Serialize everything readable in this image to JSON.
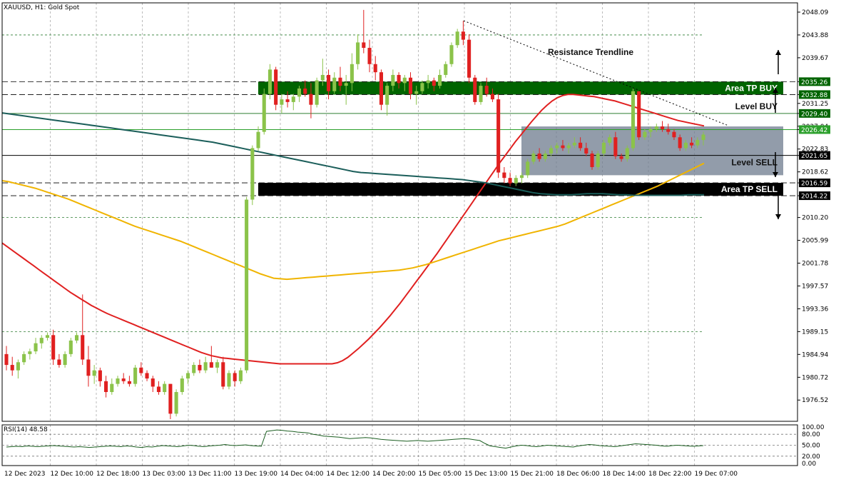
{
  "chart_data": {
    "type": "candlestick",
    "title": "XAUUSD, H1:  Gold Spot",
    "symbol": "XAUUSD",
    "timeframe": "H1",
    "instrument": "Gold Spot",
    "ylim": [
      1972.6,
      2049.8
    ],
    "y_ticks": [
      "2048.09",
      "2043.88",
      "2039.67",
      "2035.26",
      "2032.88",
      "2031.25",
      "2029.40",
      "2027.04",
      "2026.42",
      "2022.83",
      "2021.65",
      "2018.62",
      "2016.59",
      "2014.22",
      "2010.20",
      "2005.99",
      "2001.78",
      "1997.57",
      "1993.36",
      "1989.15",
      "1984.94",
      "1980.72",
      "1976.52"
    ],
    "x_labels": [
      "12 Dec 2023",
      "12 Dec 10:00",
      "12 Dec 18:00",
      "13 Dec 03:00",
      "13 Dec 11:00",
      "13 Dec 19:00",
      "14 Dec 04:00",
      "14 Dec 12:00",
      "14 Dec 20:00",
      "15 Dec 05:00",
      "15 Dec 13:00",
      "15 Dec 21:00",
      "18 Dec 06:00",
      "18 Dec 14:00",
      "18 Dec 22:00",
      "19 Dec 07:00"
    ],
    "grid": true,
    "candles": [
      [
        1985.0,
        1986.5,
        1982.0,
        1983.0
      ],
      [
        1983.0,
        1984.5,
        1981.0,
        1982.0
      ],
      [
        1982.0,
        1984.0,
        1980.5,
        1983.5
      ],
      [
        1983.5,
        1985.5,
        1983.0,
        1985.0
      ],
      [
        1985.0,
        1986.0,
        1984.0,
        1985.5
      ],
      [
        1985.5,
        1988.0,
        1985.0,
        1987.0
      ],
      [
        1987.0,
        1988.5,
        1986.0,
        1988.0
      ],
      [
        1988.0,
        1989.0,
        1987.5,
        1988.5
      ],
      [
        1988.5,
        1989.5,
        1983.0,
        1984.0
      ],
      [
        1984.0,
        1985.0,
        1982.5,
        1983.0
      ],
      [
        1983.0,
        1985.5,
        1982.5,
        1985.0
      ],
      [
        1985.0,
        1988.0,
        1984.5,
        1987.5
      ],
      [
        1987.5,
        1989.0,
        1987.0,
        1988.5
      ],
      [
        1988.5,
        1996.0,
        1983.0,
        1984.0
      ],
      [
        1984.0,
        1986.5,
        1979.0,
        1981.0
      ],
      [
        1981.0,
        1983.0,
        1979.5,
        1982.0
      ],
      [
        1982.0,
        1982.5,
        1979.0,
        1980.0
      ],
      [
        1980.0,
        1981.0,
        1977.0,
        1978.0
      ],
      [
        1978.0,
        1980.5,
        1977.5,
        1979.5
      ],
      [
        1979.5,
        1981.0,
        1979.0,
        1980.5
      ],
      [
        1980.5,
        1981.5,
        1979.5,
        1980.0
      ],
      [
        1980.0,
        1981.0,
        1979.0,
        1979.5
      ],
      [
        1979.5,
        1983.0,
        1979.0,
        1982.5
      ],
      [
        1982.5,
        1983.5,
        1981.0,
        1981.5
      ],
      [
        1981.5,
        1982.0,
        1980.0,
        1980.5
      ],
      [
        1980.5,
        1981.0,
        1978.0,
        1979.0
      ],
      [
        1979.0,
        1980.0,
        1977.5,
        1978.0
      ],
      [
        1978.0,
        1980.0,
        1977.5,
        1979.5
      ],
      [
        1979.5,
        1979.5,
        1973.0,
        1974.0
      ],
      [
        1974.0,
        1978.5,
        1973.5,
        1978.0
      ],
      [
        1978.0,
        1981.0,
        1977.5,
        1980.5
      ],
      [
        1980.5,
        1982.0,
        1979.5,
        1981.5
      ],
      [
        1981.5,
        1983.5,
        1981.0,
        1983.0
      ],
      [
        1983.0,
        1984.0,
        1981.5,
        1982.0
      ],
      [
        1982.0,
        1984.5,
        1981.5,
        1983.5
      ],
      [
        1983.5,
        1986.5,
        1982.5,
        1982.5
      ],
      [
        1982.5,
        1984.0,
        1981.5,
        1983.5
      ],
      [
        1983.5,
        1984.5,
        1978.5,
        1979.0
      ],
      [
        1979.0,
        1982.0,
        1978.5,
        1981.5
      ],
      [
        1981.5,
        1982.0,
        1979.0,
        1980.0
      ],
      [
        1980.0,
        1982.5,
        1979.5,
        1982.0
      ],
      [
        1982.0,
        2014.0,
        1981.5,
        2013.5
      ],
      [
        2013.5,
        2023.5,
        2012.5,
        2023.0
      ],
      [
        2023.0,
        2027.0,
        2022.5,
        2026.0
      ],
      [
        2026.0,
        2034.0,
        2025.5,
        2033.0
      ],
      [
        2033.0,
        2038.5,
        2032.0,
        2037.5
      ],
      [
        2037.5,
        2038.0,
        2030.0,
        2031.0
      ],
      [
        2031.0,
        2033.0,
        2029.5,
        2032.0
      ],
      [
        2032.0,
        2033.5,
        2030.5,
        2031.5
      ],
      [
        2031.5,
        2033.0,
        2030.0,
        2032.5
      ],
      [
        2032.5,
        2034.5,
        2031.5,
        2034.0
      ],
      [
        2034.0,
        2035.5,
        2032.5,
        2033.0
      ],
      [
        2033.0,
        2035.0,
        2028.5,
        2031.0
      ],
      [
        2031.0,
        2036.0,
        2030.5,
        2035.5
      ],
      [
        2035.5,
        2039.5,
        2034.5,
        2036.5
      ],
      [
        2036.5,
        2037.5,
        2032.0,
        2033.5
      ],
      [
        2033.5,
        2037.0,
        2033.0,
        2036.0
      ],
      [
        2036.0,
        2038.0,
        2033.5,
        2034.5
      ],
      [
        2034.5,
        2036.5,
        2031.0,
        2035.0
      ],
      [
        2035.0,
        2040.5,
        2033.5,
        2038.5
      ],
      [
        2038.5,
        2044.0,
        2037.5,
        2042.5
      ],
      [
        2042.5,
        2048.5,
        2040.5,
        2041.5
      ],
      [
        2041.5,
        2043.0,
        2037.0,
        2038.5
      ],
      [
        2038.5,
        2040.0,
        2035.5,
        2037.0
      ],
      [
        2037.0,
        2037.5,
        2030.0,
        2031.0
      ],
      [
        2031.0,
        2035.0,
        2029.0,
        2034.5
      ],
      [
        2034.5,
        2037.5,
        2033.5,
        2036.5
      ],
      [
        2036.5,
        2037.0,
        2034.0,
        2035.0
      ],
      [
        2035.0,
        2036.5,
        2033.5,
        2036.0
      ],
      [
        2036.0,
        2037.0,
        2032.0,
        2033.0
      ],
      [
        2033.0,
        2034.5,
        2031.0,
        2033.5
      ],
      [
        2033.5,
        2035.5,
        2033.0,
        2035.0
      ],
      [
        2035.0,
        2036.5,
        2034.0,
        2035.5
      ],
      [
        2035.5,
        2036.0,
        2033.5,
        2034.5
      ],
      [
        2034.5,
        2037.5,
        2034.0,
        2036.5
      ],
      [
        2036.5,
        2039.0,
        2036.0,
        2038.5
      ],
      [
        2038.5,
        2042.5,
        2038.0,
        2042.0
      ],
      [
        2042.0,
        2045.0,
        2041.5,
        2044.5
      ],
      [
        2044.5,
        2046.5,
        2042.0,
        2043.0
      ],
      [
        2043.0,
        2044.0,
        2035.0,
        2036.0
      ],
      [
        2036.0,
        2036.5,
        2031.0,
        2031.5
      ],
      [
        2031.5,
        2035.0,
        2031.0,
        2034.5
      ],
      [
        2034.5,
        2036.0,
        2032.5,
        2033.0
      ],
      [
        2033.0,
        2034.0,
        2031.5,
        2032.0
      ],
      [
        2032.0,
        2033.0,
        2017.5,
        2018.5
      ],
      [
        2018.5,
        2019.5,
        2016.5,
        2017.5
      ],
      [
        2017.5,
        2018.5,
        2016.0,
        2016.5
      ],
      [
        2016.5,
        2018.0,
        2016.0,
        2017.5
      ],
      [
        2017.5,
        2018.5,
        2016.5,
        2018.0
      ],
      [
        2018.0,
        2021.0,
        2017.5,
        2020.5
      ],
      [
        2020.5,
        2022.5,
        2020.0,
        2022.0
      ],
      [
        2022.0,
        2023.0,
        2020.5,
        2021.0
      ],
      [
        2021.0,
        2022.5,
        2020.5,
        2022.0
      ],
      [
        2022.0,
        2023.5,
        2021.5,
        2023.0
      ],
      [
        2023.0,
        2024.0,
        2022.0,
        2023.5
      ],
      [
        2023.5,
        2024.5,
        2022.5,
        2023.0
      ],
      [
        2023.0,
        2024.0,
        2022.0,
        2023.5
      ],
      [
        2023.5,
        2025.0,
        2023.0,
        2024.0
      ],
      [
        2024.0,
        2025.0,
        2022.5,
        2023.0
      ],
      [
        2023.0,
        2024.0,
        2021.5,
        2022.0
      ],
      [
        2022.0,
        2022.5,
        2019.0,
        2019.5
      ],
      [
        2019.5,
        2022.5,
        2019.0,
        2022.0
      ],
      [
        2022.0,
        2024.5,
        2021.5,
        2024.0
      ],
      [
        2024.0,
        2025.5,
        2023.5,
        2025.0
      ],
      [
        2025.0,
        2026.0,
        2021.0,
        2021.5
      ],
      [
        2021.5,
        2022.0,
        2020.5,
        2021.0
      ],
      [
        2021.0,
        2023.5,
        2020.5,
        2023.0
      ],
      [
        2023.0,
        2034.0,
        2022.5,
        2033.5
      ],
      [
        2033.5,
        2033.5,
        2024.5,
        2025.0
      ],
      [
        2025.0,
        2026.5,
        2024.5,
        2026.0
      ],
      [
        2026.0,
        2027.0,
        2025.0,
        2026.5
      ],
      [
        2026.5,
        2027.5,
        2026.0,
        2027.0
      ],
      [
        2027.0,
        2028.0,
        2026.0,
        2026.5
      ],
      [
        2026.5,
        2027.5,
        2025.5,
        2026.0
      ],
      [
        2026.0,
        2026.5,
        2024.5,
        2025.0
      ],
      [
        2025.0,
        2025.5,
        2022.5,
        2023.0
      ],
      [
        2023.0,
        2024.5,
        2022.5,
        2024.0
      ],
      [
        2024.0,
        2025.0,
        2023.0,
        2023.5
      ],
      [
        2023.5,
        2025.0,
        2023.0,
        2024.5
      ],
      [
        2024.5,
        2026.0,
        2023.5,
        2025.5
      ]
    ],
    "ma_red": [
      2005.5,
      2004.8,
      2004.1,
      2003.4,
      2002.7,
      2002.0,
      2001.3,
      2000.6,
      1999.9,
      1999.2,
      1998.5,
      1997.8,
      1997.1,
      1996.4,
      1995.8,
      1995.2,
      1994.6,
      1994.0,
      1993.5,
      1993.0,
      1992.5,
      1992.1,
      1991.7,
      1991.3,
      1990.9,
      1990.5,
      1990.1,
      1989.7,
      1989.3,
      1988.9,
      1988.5,
      1988.1,
      1987.7,
      1987.3,
      1986.9,
      1986.5,
      1986.1,
      1985.7,
      1985.3,
      1985.0,
      1984.7,
      1984.5,
      1984.3,
      1984.2,
      1984.1,
      1984.0,
      1983.9,
      1983.8,
      1983.7,
      1983.6,
      1983.5,
      1983.4,
      1983.3,
      1983.2,
      1983.2,
      1983.2,
      1983.2,
      1983.2,
      1983.2,
      1983.2,
      1983.2,
      1983.2,
      1983.2,
      1983.2,
      1983.4,
      1983.8,
      1984.4,
      1985.2,
      1986.0,
      1986.9,
      1987.8,
      1988.8,
      1989.8,
      1990.9,
      1992.0,
      1993.2,
      1994.4,
      1995.7,
      1997.0,
      1998.3,
      1999.6,
      2000.9,
      2002.2,
      2003.5,
      2004.9,
      2006.3,
      2007.7,
      2009.1,
      2010.5,
      2011.9,
      2013.3,
      2014.7,
      2016.1,
      2017.5,
      2018.9,
      2020.3,
      2021.6,
      2022.9,
      2024.2,
      2025.4,
      2026.6,
      2027.8,
      2028.9,
      2030.0,
      2030.9,
      2031.7,
      2032.3,
      2032.7,
      2032.9,
      2032.9,
      2032.8,
      2032.7,
      2032.6,
      2032.5,
      2032.3,
      2032.1,
      2031.9,
      2031.7,
      2031.4,
      2031.1,
      2030.8,
      2030.5,
      2030.2,
      2029.9,
      2029.6,
      2029.3,
      2029.0,
      2028.7,
      2028.4,
      2028.1,
      2027.9,
      2027.7,
      2027.5,
      2027.3,
      2027.1
    ],
    "ma_yellow": [
      2017.0,
      2016.8,
      2016.5,
      2016.2,
      2015.9,
      2015.6,
      2015.2,
      2014.8,
      2014.4,
      2014.0,
      2013.6,
      2013.1,
      2012.6,
      2012.1,
      2011.6,
      2011.1,
      2010.6,
      2010.1,
      2009.6,
      2009.1,
      2008.6,
      2008.2,
      2007.8,
      2007.4,
      2007.0,
      2006.6,
      2006.2,
      2005.8,
      2005.3,
      2004.8,
      2004.3,
      2003.8,
      2003.3,
      2002.8,
      2002.3,
      2001.8,
      2001.3,
      2000.8,
      2000.3,
      1999.8,
      1999.4,
      1999.0,
      1998.9,
      1998.8,
      1998.9,
      1999.0,
      1999.1,
      1999.2,
      1999.3,
      1999.4,
      1999.5,
      1999.6,
      1999.7,
      1999.8,
      1999.9,
      2000.0,
      2000.1,
      2000.2,
      2000.3,
      2000.4,
      2000.5,
      2000.7,
      2000.9,
      2001.2,
      2001.5,
      2001.9,
      2002.3,
      2002.7,
      2003.1,
      2003.5,
      2003.9,
      2004.3,
      2004.7,
      2005.1,
      2005.5,
      2005.9,
      2006.2,
      2006.5,
      2006.8,
      2007.1,
      2007.4,
      2007.7,
      2008.0,
      2008.3,
      2008.6,
      2009.0,
      2009.5,
      2010.0,
      2010.5,
      2011.0,
      2011.5,
      2012.0,
      2012.5,
      2013.0,
      2013.5,
      2014.0,
      2014.5,
      2015.0,
      2015.5,
      2016.0,
      2016.6,
      2017.2,
      2017.8,
      2018.4,
      2019.0,
      2019.6,
      2020.2
    ],
    "ma_teal": [
      2029.5,
      2029.3,
      2029.1,
      2028.9,
      2028.7,
      2028.5,
      2028.3,
      2028.1,
      2027.9,
      2027.7,
      2027.5,
      2027.3,
      2027.1,
      2026.9,
      2026.7,
      2026.5,
      2026.3,
      2026.1,
      2025.9,
      2025.7,
      2025.5,
      2025.3,
      2025.1,
      2024.9,
      2024.7,
      2024.5,
      2024.3,
      2024.1,
      2023.8,
      2023.5,
      2023.2,
      2022.9,
      2022.6,
      2022.3,
      2022.0,
      2021.7,
      2021.4,
      2021.1,
      2020.8,
      2020.5,
      2020.2,
      2019.9,
      2019.6,
      2019.3,
      2019.0,
      2018.7,
      2018.5,
      2018.4,
      2018.3,
      2018.2,
      2018.1,
      2018.0,
      2017.9,
      2017.8,
      2017.7,
      2017.6,
      2017.5,
      2017.4,
      2017.3,
      2017.2,
      2017.0,
      2016.8,
      2016.6,
      2016.3,
      2016.0,
      2015.7,
      2015.4,
      2015.1,
      2014.8,
      2014.6,
      2014.5,
      2014.4,
      2014.4,
      2014.4,
      2014.5,
      2014.6,
      2014.6,
      2014.6,
      2014.5,
      2014.4,
      2014.4,
      2014.3,
      2014.3,
      2014.3,
      2014.3,
      2014.3,
      2014.3,
      2014.3,
      2014.4,
      2014.4,
      2014.4
    ],
    "levels": {
      "area_tp_buy": {
        "label": "Area TP BUY",
        "from": 2032.88,
        "to": 2035.26,
        "color": "#006400"
      },
      "level_buy": {
        "label": "Level BUY",
        "value": 2029.4
      },
      "level_sell": {
        "label": "Level SELL",
        "value": 2021.65
      },
      "area_tp_sell": {
        "label": "Area TP SELL",
        "from": 2014.22,
        "to": 2016.59,
        "color": "#000000"
      },
      "consolidation_box": {
        "from": 2018.0,
        "to": 2027.0,
        "color": "#6d7b8d"
      }
    },
    "annotations": {
      "resistance": "Resistance Trendline"
    },
    "price_badges": [
      {
        "value": "2035.26",
        "price": 2035.26,
        "bg": "#006400"
      },
      {
        "value": "2032.88",
        "price": 2032.88,
        "bg": "#006400"
      },
      {
        "value": "2029.40",
        "price": 2029.4,
        "bg": "#006400"
      },
      {
        "value": "2026.42",
        "price": 2026.42,
        "bg": "#2ca02c"
      },
      {
        "value": "2021.65",
        "price": 2021.65,
        "bg": "#000000"
      },
      {
        "value": "2016.59",
        "price": 2016.59,
        "bg": "#000000"
      },
      {
        "value": "2014.22",
        "price": 2014.22,
        "bg": "#000000"
      }
    ],
    "rsi": {
      "label": "RSI(14) 48.58",
      "ylim": [
        0,
        100
      ],
      "y_ticks": [
        "100.00",
        "80.00",
        "50.00",
        "20.00",
        "0.00"
      ],
      "values": [
        45,
        46,
        47,
        46,
        48,
        47,
        46,
        47,
        48,
        49,
        48,
        47,
        46,
        45,
        46,
        45,
        44,
        45,
        46,
        47,
        48,
        47,
        46,
        48,
        47,
        45,
        44,
        46,
        45,
        47,
        49,
        48,
        47,
        46,
        48,
        50,
        49,
        47,
        46,
        48,
        49,
        50,
        52,
        50,
        49,
        50,
        51,
        49,
        48,
        47,
        88,
        90,
        92,
        91,
        89,
        88,
        86,
        85,
        84,
        80,
        78,
        75,
        74,
        73,
        72,
        70,
        68,
        69,
        70,
        71,
        70,
        68,
        66,
        65,
        64,
        63,
        62,
        61,
        62,
        63,
        62,
        61,
        62,
        63,
        64,
        65,
        66,
        67,
        68,
        67,
        65,
        63,
        55,
        48,
        46,
        44,
        42,
        45,
        48,
        50,
        49,
        47,
        46,
        48,
        50,
        49,
        48,
        47,
        46,
        45,
        48,
        50,
        52,
        51,
        49,
        48,
        47,
        46,
        48,
        50,
        52,
        54,
        53,
        52,
        51,
        50,
        48,
        47,
        49,
        50,
        49,
        48,
        47,
        48,
        49
      ]
    },
    "colors": {
      "bull": "#8bc34a",
      "bear": "#e02020",
      "ma_red": "#e02020",
      "ma_yellow": "#f0b400",
      "ma_teal": "#1b5e5a",
      "grid": "#bbbbbb"
    }
  }
}
